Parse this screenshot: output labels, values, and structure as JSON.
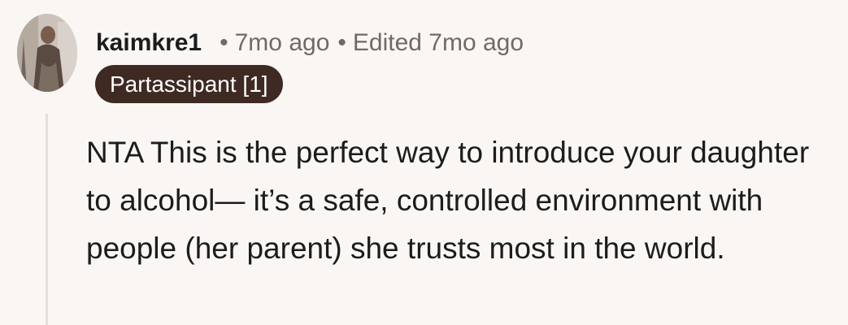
{
  "comment": {
    "username": "kaimkre1",
    "separator": "•",
    "time_ago": "7mo ago",
    "edited_label": "Edited 7mo ago",
    "flair": "Partassipant [1]",
    "avatar_icon": "user-avatar-photo",
    "text": "NTA This is the perfect way to introduce your daughter to alcohol— it’s a safe, controlled environment with people (her parent) she trusts most in the world."
  },
  "colors": {
    "background": "#f9f6f4",
    "flair_background": "#3e2a23",
    "meta_text": "#6f6a66",
    "body_text": "#1c1c1c",
    "thread_line": "#e6dfd9"
  }
}
